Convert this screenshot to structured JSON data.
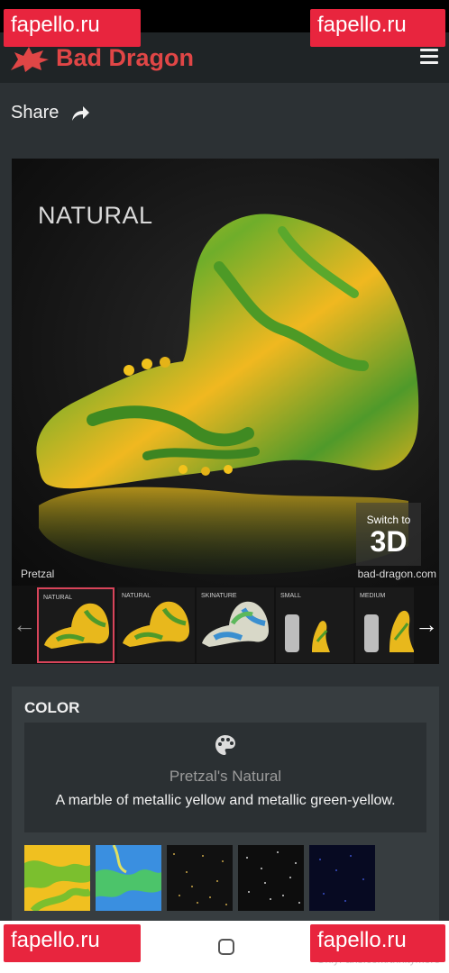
{
  "status_bar": {
    "right_text": "…"
  },
  "header": {
    "brand": "Bad Dragon"
  },
  "share": {
    "label": "Share"
  },
  "product_image": {
    "variant_caption": "NATURAL",
    "switch_small": "Switch to",
    "switch_big": "3D",
    "product_name": "Pretzal",
    "site": "bad-dragon.com"
  },
  "thumbnails": [
    {
      "label": "NATURAL",
      "active": true
    },
    {
      "label": "NATURAL",
      "active": false
    },
    {
      "label": "SKINATURE",
      "active": false
    },
    {
      "label": "SMALL",
      "active": false
    },
    {
      "label": "MEDIUM",
      "active": false
    }
  ],
  "color_section": {
    "heading": "COLOR",
    "name": "Pretzal's Natural",
    "description": "A marble of metallic yellow and metallic green-yellow."
  },
  "swatches": [
    {
      "name": "natural-marble",
      "colors": [
        "#f0c020",
        "#7bbf2e"
      ]
    },
    {
      "name": "blue-green-marble",
      "colors": [
        "#3a8fe0",
        "#4cc46a"
      ]
    },
    {
      "name": "gold-glitter",
      "colors": [
        "#111111",
        "#c9a648"
      ]
    },
    {
      "name": "silver-glitter",
      "colors": [
        "#0d0d0d",
        "#d0d0d0"
      ]
    },
    {
      "name": "blue-glitter",
      "colors": [
        "#070a22",
        "#2a3ca0"
      ]
    }
  ],
  "watermarks": {
    "badge": "fapello.ru",
    "footer": "OnlyFans.com/trinitymore"
  },
  "colors": {
    "brand_red": "#e04646",
    "badge_red": "#e8253e",
    "active_thumb": "#d8445a",
    "page_bg": "#2c3134"
  }
}
